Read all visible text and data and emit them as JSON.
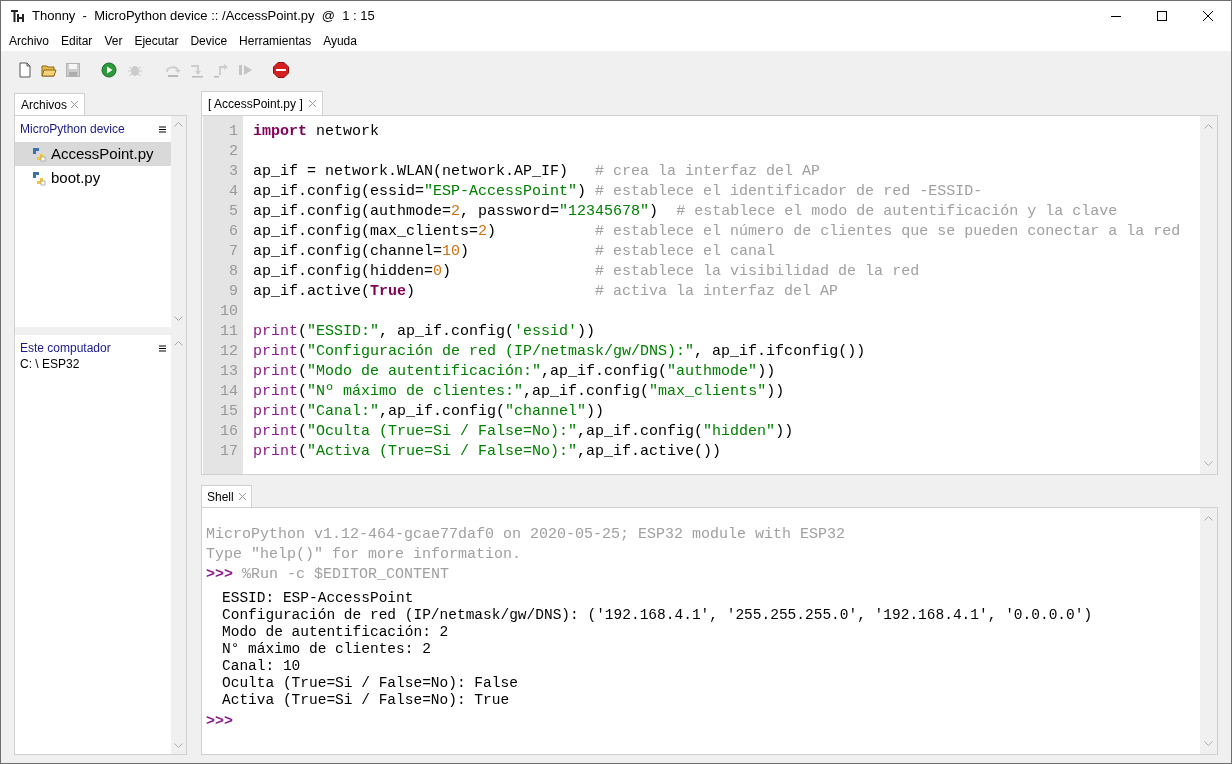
{
  "window": {
    "title": "Thonny  -  MicroPython device :: /AccessPoint.py  @  1 : 15"
  },
  "menu": [
    "Archivo",
    "Editar",
    "Ver",
    "Ejecutar",
    "Device",
    "Herramientas",
    "Ayuda"
  ],
  "toolbar": [
    {
      "kind": "new",
      "disabled": false
    },
    {
      "kind": "open",
      "disabled": false
    },
    {
      "kind": "save",
      "disabled": true
    },
    {
      "kind": "run",
      "disabled": false
    },
    {
      "kind": "debug",
      "disabled": true
    },
    {
      "kind": "step-over",
      "disabled": true
    },
    {
      "kind": "step-into",
      "disabled": true
    },
    {
      "kind": "step-out",
      "disabled": true
    },
    {
      "kind": "resume",
      "disabled": true
    },
    {
      "kind": "stop",
      "disabled": false
    }
  ],
  "files_panel": {
    "tab": "Archivos",
    "device": {
      "title": "MicroPython device",
      "items": [
        {
          "name": "AccessPoint.py",
          "selected": true
        },
        {
          "name": "boot.py",
          "selected": false
        }
      ]
    },
    "computer": {
      "title": "Este computador",
      "path": "C: \\ ESP32"
    }
  },
  "editor": {
    "tab": "[ AccessPoint.py ]",
    "lines": [
      {
        "number": "1",
        "tokens": [
          {
            "kind": "keyword",
            "text": "import"
          },
          {
            "kind": "plain",
            "text": " network"
          }
        ]
      },
      {
        "number": "2"
      },
      {
        "number": "3",
        "tokens": [
          {
            "kind": "plain",
            "text": "ap_if = network.WLAN(network.AP_IF)   "
          },
          {
            "kind": "comment",
            "text": "# crea la interfaz del AP"
          }
        ]
      },
      {
        "number": "4",
        "tokens": [
          {
            "kind": "plain",
            "text": "ap_if.config(essid="
          },
          {
            "kind": "string",
            "text": "\"ESP-AccessPoint\""
          },
          {
            "kind": "plain",
            "text": ") "
          },
          {
            "kind": "comment",
            "text": "# establece el identificador de red -ESSID-"
          }
        ]
      },
      {
        "number": "5",
        "tokens": [
          {
            "kind": "plain",
            "text": "ap_if.config(authmode="
          },
          {
            "kind": "number",
            "text": "2"
          },
          {
            "kind": "plain",
            "text": ", password="
          },
          {
            "kind": "string",
            "text": "\"12345678\""
          },
          {
            "kind": "plain",
            "text": ")  "
          },
          {
            "kind": "comment",
            "text": "# establece el modo de autentificación y la clave"
          }
        ]
      },
      {
        "number": "6",
        "tokens": [
          {
            "kind": "plain",
            "text": "ap_if.config(max_clients="
          },
          {
            "kind": "number",
            "text": "2"
          },
          {
            "kind": "plain",
            "text": ")           "
          },
          {
            "kind": "comment",
            "text": "# establece el número de clientes que se pueden conectar a la red"
          }
        ]
      },
      {
        "number": "7",
        "tokens": [
          {
            "kind": "plain",
            "text": "ap_if.config(channel="
          },
          {
            "kind": "number",
            "text": "10"
          },
          {
            "kind": "plain",
            "text": ")              "
          },
          {
            "kind": "comment",
            "text": "# establece el canal"
          }
        ]
      },
      {
        "number": "8",
        "tokens": [
          {
            "kind": "plain",
            "text": "ap_if.config(hidden="
          },
          {
            "kind": "number",
            "text": "0"
          },
          {
            "kind": "plain",
            "text": ")                "
          },
          {
            "kind": "comment",
            "text": "# establece la visibilidad de la red"
          }
        ]
      },
      {
        "number": "9",
        "tokens": [
          {
            "kind": "plain",
            "text": "ap_if.active("
          },
          {
            "kind": "keyword",
            "text": "True"
          },
          {
            "kind": "plain",
            "text": ")                    "
          },
          {
            "kind": "comment",
            "text": "# activa la interfaz del AP"
          }
        ]
      },
      {
        "number": "10"
      },
      {
        "number": "11",
        "tokens": [
          {
            "kind": "builtin",
            "text": "print"
          },
          {
            "kind": "plain",
            "text": "("
          },
          {
            "kind": "string",
            "text": "\"ESSID:\""
          },
          {
            "kind": "plain",
            "text": ", ap_if.config("
          },
          {
            "kind": "string",
            "text": "'essid'"
          },
          {
            "kind": "plain",
            "text": "))"
          }
        ]
      },
      {
        "number": "12",
        "tokens": [
          {
            "kind": "builtin",
            "text": "print"
          },
          {
            "kind": "plain",
            "text": "("
          },
          {
            "kind": "string",
            "text": "\"Configuración de red (IP/netmask/gw/DNS):\""
          },
          {
            "kind": "plain",
            "text": ", ap_if.ifconfig())"
          }
        ]
      },
      {
        "number": "13",
        "tokens": [
          {
            "kind": "builtin",
            "text": "print"
          },
          {
            "kind": "plain",
            "text": "("
          },
          {
            "kind": "string",
            "text": "\"Modo de autentificación:\""
          },
          {
            "kind": "plain",
            "text": ",ap_if.config("
          },
          {
            "kind": "string",
            "text": "\"authmode\""
          },
          {
            "kind": "plain",
            "text": "))"
          }
        ]
      },
      {
        "number": "14",
        "tokens": [
          {
            "kind": "builtin",
            "text": "print"
          },
          {
            "kind": "plain",
            "text": "("
          },
          {
            "kind": "string",
            "text": "\"Nº máximo de clientes:\""
          },
          {
            "kind": "plain",
            "text": ",ap_if.config("
          },
          {
            "kind": "string",
            "text": "\"max_clients\""
          },
          {
            "kind": "plain",
            "text": "))"
          }
        ]
      },
      {
        "number": "15",
        "tokens": [
          {
            "kind": "builtin",
            "text": "print"
          },
          {
            "kind": "plain",
            "text": "("
          },
          {
            "kind": "string",
            "text": "\"Canal:\""
          },
          {
            "kind": "plain",
            "text": ",ap_if.config("
          },
          {
            "kind": "string",
            "text": "\"channel\""
          },
          {
            "kind": "plain",
            "text": "))"
          }
        ]
      },
      {
        "number": "16",
        "tokens": [
          {
            "kind": "builtin",
            "text": "print"
          },
          {
            "kind": "plain",
            "text": "("
          },
          {
            "kind": "string",
            "text": "\"Oculta (True=Si / False=No):\""
          },
          {
            "kind": "plain",
            "text": ",ap_if.config("
          },
          {
            "kind": "string",
            "text": "\"hidden\""
          },
          {
            "kind": "plain",
            "text": "))"
          }
        ]
      },
      {
        "number": "17",
        "tokens": [
          {
            "kind": "builtin",
            "text": "print"
          },
          {
            "kind": "plain",
            "text": "("
          },
          {
            "kind": "string",
            "text": "\"Activa (True=Si / False=No):\""
          },
          {
            "kind": "plain",
            "text": ",ap_if.active())"
          }
        ]
      }
    ]
  },
  "shell": {
    "tab": "Shell",
    "banner": [
      "MicroPython v1.12-464-gcae77daf0 on 2020-05-25; ESP32 module with ESP32",
      "Type \"help()\" for more information."
    ],
    "command": {
      "prompt": ">>>",
      "text": "%Run -c $EDITOR_CONTENT"
    },
    "output": [
      "ESSID: ESP-AccessPoint",
      "Configuración de red (IP/netmask/gw/DNS): ('192.168.4.1', '255.255.255.0', '192.168.4.1', '0.0.0.0')",
      "Modo de autentificación: 2",
      "N° máximo de clientes: 2",
      "Canal: 10",
      "Oculta (True=Si / False=No): False",
      "Activa (True=Si / False=No): True"
    ],
    "prompt": ">>>"
  }
}
